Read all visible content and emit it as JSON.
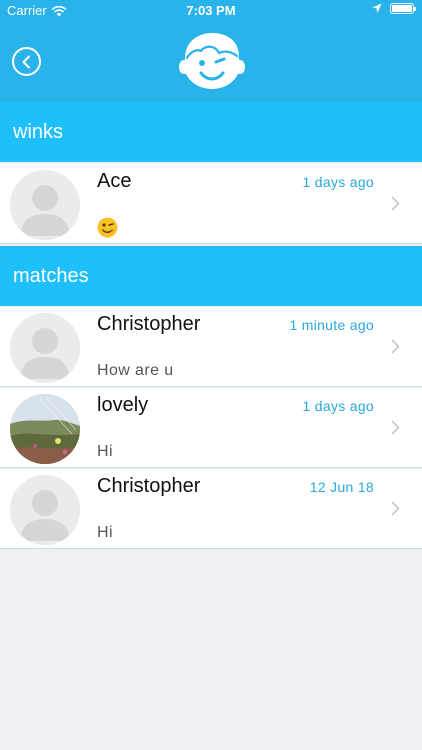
{
  "status_bar": {
    "carrier": "Carrier",
    "time": "7:03 PM"
  },
  "header": {
    "back_icon": "back-circle-icon",
    "logo_icon": "winking-boy-face-icon"
  },
  "sections": [
    {
      "title": "winks",
      "items": [
        {
          "name": "Ace",
          "time": "1 days ago",
          "message_emoji": "winking-face-emoji",
          "avatar": "placeholder-avatar"
        }
      ]
    },
    {
      "title": "matches",
      "items": [
        {
          "name": "Christopher",
          "time": "1 minute ago",
          "message": "How are u",
          "avatar": "placeholder-avatar"
        },
        {
          "name": "lovely",
          "time": "1 days ago",
          "message": "Hi",
          "avatar": "landscape-photo"
        },
        {
          "name": "Christopher",
          "time": "12 Jun 18",
          "message": "Hi",
          "avatar": "placeholder-avatar"
        }
      ]
    }
  ],
  "colors": {
    "header_bg": "#29b3ea",
    "section_bg": "#1ec0fb",
    "time_text": "#29a8de",
    "page_bg": "#efeff4"
  }
}
